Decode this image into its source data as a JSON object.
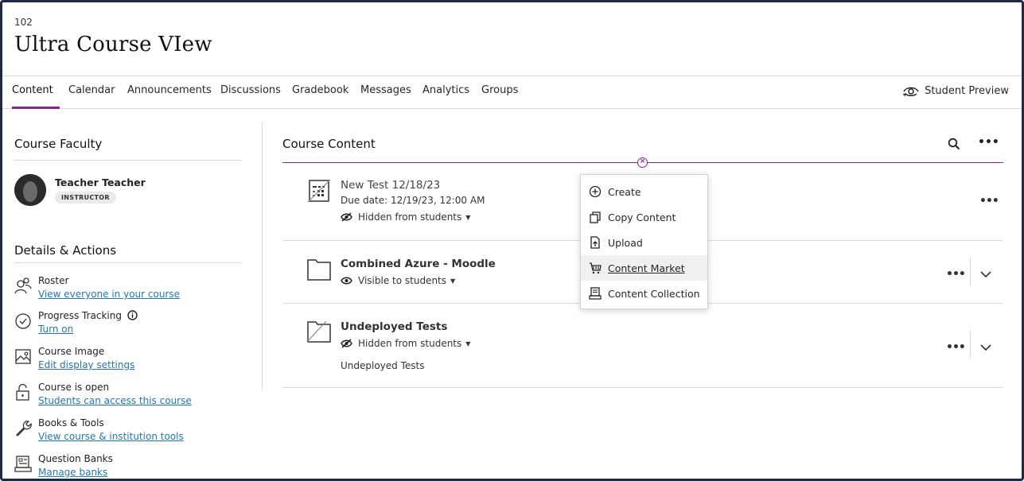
{
  "course": {
    "code": "102",
    "title": "Ultra Course VIew"
  },
  "tabs": [
    {
      "label": "Content"
    },
    {
      "label": "Calendar"
    },
    {
      "label": "Announcements"
    },
    {
      "label": "Discussions"
    },
    {
      "label": "Gradebook"
    },
    {
      "label": "Messages"
    },
    {
      "label": "Analytics"
    },
    {
      "label": "Groups"
    }
  ],
  "active_tab": "Content",
  "student_preview": {
    "label": "Student Preview",
    "icon": "eye-preview-icon"
  },
  "sidebar": {
    "faculty_heading": "Course Faculty",
    "teacher": {
      "name": "Teacher Teacher",
      "role": "INSTRUCTOR"
    },
    "details_heading": "Details & Actions",
    "actions": [
      {
        "title": "Roster",
        "link": "View everyone in your course",
        "icon": "roster-icon"
      },
      {
        "title": "Progress Tracking",
        "link": "Turn on",
        "icon": "progress-check-icon",
        "info_icon": "info-icon"
      },
      {
        "title": "Course Image",
        "link": "Edit display settings",
        "icon": "image-icon"
      },
      {
        "title": "Course is open",
        "link": "Students can access this course",
        "icon": "unlock-icon"
      },
      {
        "title": "Books & Tools",
        "link": "View course & institution tools",
        "icon": "wrench-icon"
      },
      {
        "title": "Question Banks",
        "link": "Manage banks",
        "icon": "question-bank-icon"
      }
    ]
  },
  "main": {
    "heading": "Course Content",
    "items": [
      {
        "title": "New Test 12/18/23",
        "due": "Due date: 12/19/23, 12:00 AM",
        "visibility": "Hidden from students",
        "icon": "test-hidden-icon"
      },
      {
        "title": "Combined Azure - Moodle",
        "visibility": "Visible to students",
        "icon": "folder-icon"
      },
      {
        "title": "Undeployed Tests",
        "visibility": "Hidden from students",
        "description": "Undeployed Tests",
        "icon": "folder-hidden-icon"
      }
    ]
  },
  "create_menu": {
    "items": [
      {
        "label": "Create",
        "icon": "plus-circle-icon"
      },
      {
        "label": "Copy Content",
        "icon": "copy-icon"
      },
      {
        "label": "Upload",
        "icon": "upload-icon"
      },
      {
        "label": "Content Market",
        "icon": "market-icon",
        "highlighted": true
      },
      {
        "label": "Content Collection",
        "icon": "collection-icon"
      }
    ]
  },
  "colors": {
    "accent": "#8a2596",
    "link": "#2477b3",
    "border": "#1f2a44"
  }
}
